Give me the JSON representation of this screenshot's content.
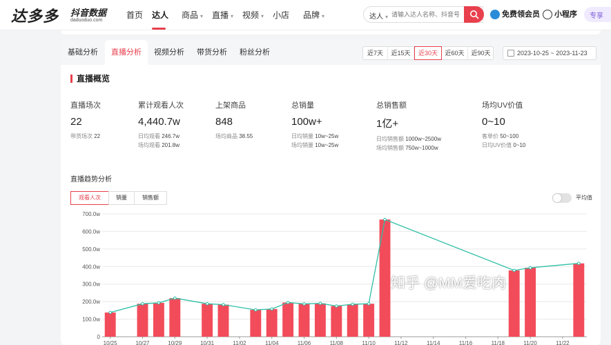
{
  "app": {
    "logo": "达多多",
    "logo_sub": "抖音数据",
    "logo_url": "daduoduo.com"
  },
  "nav": {
    "items": [
      "首页",
      "达人",
      "商品",
      "直播",
      "视频",
      "小店",
      "品牌"
    ],
    "active": "达人"
  },
  "search": {
    "type": "达人",
    "placeholder": "请输入达人名称、抖音号"
  },
  "header_links": {
    "vip": "免费领会员",
    "mini": "小程序",
    "extra": "专享"
  },
  "tabs": {
    "items": [
      "基础分析",
      "直播分析",
      "视频分析",
      "带货分析",
      "粉丝分析"
    ],
    "active": "直播分析"
  },
  "ranges": {
    "items": [
      "近7天",
      "近15天",
      "近30天",
      "近60天",
      "近90天"
    ],
    "active": "近30天",
    "date_range": "2023-10-25 ~ 2023-11-23"
  },
  "overview": {
    "title": "直播概览",
    "metrics": [
      {
        "label": "直播场次",
        "value": "22",
        "subs": [
          {
            "k": "带货场次",
            "v": "22"
          }
        ]
      },
      {
        "label": "累计观看人次",
        "value": "4,440.7w",
        "subs": [
          {
            "k": "日均观看",
            "v": "246.7w"
          },
          {
            "k": "场均观看",
            "v": "201.8w"
          }
        ]
      },
      {
        "label": "上架商品",
        "value": "848",
        "subs": [
          {
            "k": "场均商品",
            "v": "38.55"
          }
        ]
      },
      {
        "label": "总销量",
        "value": "100w+",
        "subs": [
          {
            "k": "日均销量",
            "v": "10w~25w"
          },
          {
            "k": "场均销量",
            "v": "10w~25w"
          }
        ]
      },
      {
        "label": "总销售额",
        "value": "1亿+",
        "subs": [
          {
            "k": "日均销售额",
            "v": "1000w~2500w"
          },
          {
            "k": "场均销售额",
            "v": "750w~1000w"
          }
        ]
      },
      {
        "label": "场均UV价值",
        "value": "0~10",
        "subs": [
          {
            "k": "客单价",
            "v": "50~100"
          },
          {
            "k": "日均UV价值",
            "v": "0~10"
          }
        ]
      }
    ]
  },
  "trend": {
    "title": "直播趋势分析",
    "tabs": [
      "观看人次",
      "销量",
      "销售额"
    ],
    "active_tab": "观看人次",
    "toggle_label": "平均值",
    "toggle_on": false
  },
  "chart_data": {
    "type": "bar",
    "ylim": [
      0,
      700
    ],
    "y_ticks": [
      "0",
      "100.0w",
      "200.0w",
      "300.0w",
      "400.0w",
      "500.0w",
      "600.0w",
      "700.0w"
    ],
    "x_tick_labels": [
      "10/25",
      "10/27",
      "10/29",
      "10/31",
      "11/02",
      "11/04",
      "11/06",
      "11/08",
      "11/10",
      "11/12",
      "11/14",
      "11/16",
      "11/18",
      "11/20",
      "11/22"
    ],
    "dates": [
      "10/25",
      "10/26",
      "10/27",
      "10/28",
      "10/29",
      "10/30",
      "10/31",
      "11/01",
      "11/02",
      "11/03",
      "11/04",
      "11/05",
      "11/06",
      "11/07",
      "11/08",
      "11/09",
      "11/10",
      "11/11",
      "11/12",
      "11/13",
      "11/14",
      "11/15",
      "11/16",
      "11/17",
      "11/18",
      "11/19",
      "11/20",
      "11/21",
      "11/22",
      "11/23"
    ],
    "series": [
      {
        "values": [
          138,
          null,
          188,
          193,
          220,
          null,
          188,
          183,
          null,
          153,
          158,
          195,
          187,
          190,
          175,
          185,
          188,
          668,
          null,
          null,
          null,
          null,
          null,
          null,
          null,
          378,
          393,
          null,
          null,
          418
        ],
        "bar_color": "#f24c5b",
        "line_color": "#2dbfa5"
      }
    ],
    "watermark": "知乎 @MM爱吃肉"
  }
}
